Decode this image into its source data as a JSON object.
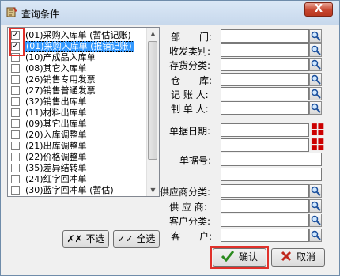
{
  "window": {
    "title": "查询条件",
    "close_label": "X"
  },
  "list": {
    "items": [
      {
        "label": "(01)采购入库单 (暂估记账)",
        "checked": true,
        "selected": false
      },
      {
        "label": "(01)采购入库单 (报销记账)",
        "checked": true,
        "selected": true
      },
      {
        "label": "(10)产成品入库单",
        "checked": false,
        "selected": false
      },
      {
        "label": "(08)其它入库单",
        "checked": false,
        "selected": false
      },
      {
        "label": "(26)销售专用发票",
        "checked": false,
        "selected": false
      },
      {
        "label": "(27)销售普通发票",
        "checked": false,
        "selected": false
      },
      {
        "label": "(32)销售出库单",
        "checked": false,
        "selected": false
      },
      {
        "label": "(11)材料出库单",
        "checked": false,
        "selected": false
      },
      {
        "label": "(09)其它出库单",
        "checked": false,
        "selected": false
      },
      {
        "label": "(20)入库调整单",
        "checked": false,
        "selected": false
      },
      {
        "label": "(21)出库调整单",
        "checked": false,
        "selected": false
      },
      {
        "label": "(22)价格调整单",
        "checked": false,
        "selected": false
      },
      {
        "label": "(35)差异结转单",
        "checked": false,
        "selected": false
      },
      {
        "label": "(24)红字回冲单",
        "checked": false,
        "selected": false
      },
      {
        "label": "(30)蓝字回冲单 (暂估)",
        "checked": false,
        "selected": false
      }
    ]
  },
  "buttons": {
    "deselect_all": "不选",
    "select_all": "全选",
    "confirm": "确认",
    "cancel": "取消",
    "confirm_icon": "check-icon",
    "cancel_icon": "x-icon"
  },
  "fields": {
    "department": {
      "label": "部　　门:",
      "value": ""
    },
    "send_category": {
      "label": "收发类别:",
      "value": ""
    },
    "inventory_category": {
      "label": "存货分类:",
      "value": ""
    },
    "warehouse": {
      "label": "仓　　库:",
      "value": ""
    },
    "bookkeeper": {
      "label": "记 账 人:",
      "value": ""
    },
    "creator": {
      "label": "制 单 人:",
      "value": ""
    },
    "doc_date": {
      "label": "单据日期:",
      "value": ""
    },
    "doc_date_to": {
      "value": ""
    },
    "doc_no": {
      "label": "单据号:",
      "value": ""
    },
    "doc_no_to": {
      "value": ""
    },
    "supplier_category": {
      "label": "供应商分类:",
      "value": ""
    },
    "supplier": {
      "label": "供 应 商:",
      "value": ""
    },
    "customer_category": {
      "label": "客户分类:",
      "value": ""
    },
    "customer": {
      "label": "客　　户:",
      "value": ""
    }
  },
  "colors": {
    "selection": "#3399ff",
    "highlight_box": "#e0302a"
  }
}
